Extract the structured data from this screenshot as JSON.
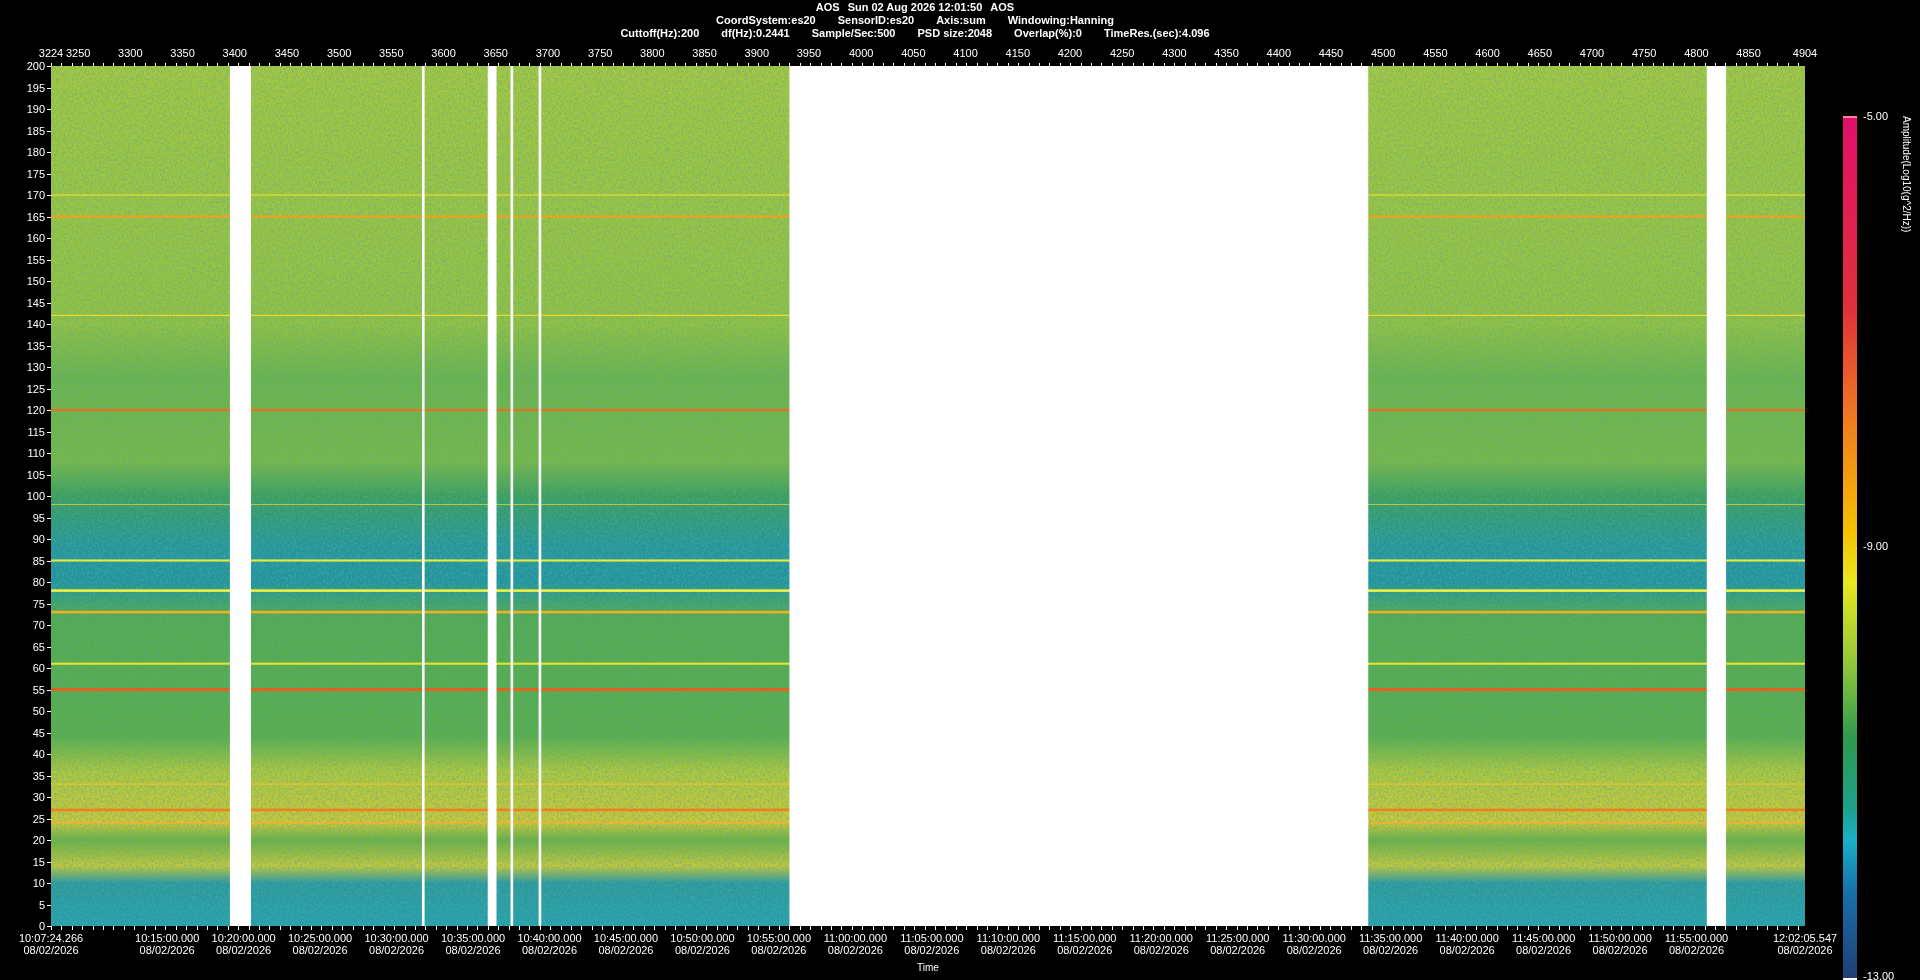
{
  "header": {
    "title": [
      "AOS",
      "Sun 02 Aug 2026 12:01:50",
      "AOS"
    ],
    "lines": [
      [
        "CoordSystem:es20",
        "SensorID:es20",
        "Axis:sum",
        "Windowing:Hanning"
      ],
      [
        "Cuttoff(Hz):200",
        "df(Hz):0.2441",
        "Sample/Sec:500",
        "PSD size:2048",
        "Overlap(%):0",
        "TimeRes.(sec):4.096"
      ]
    ]
  },
  "index_axis": {
    "labels": [
      "3224",
      "3250",
      "3300",
      "3350",
      "3400",
      "3450",
      "3500",
      "3550",
      "3600",
      "3650",
      "3700",
      "3750",
      "3800",
      "3850",
      "3900",
      "3950",
      "4000",
      "4050",
      "4100",
      "4150",
      "4200",
      "4250",
      "4300",
      "4350",
      "4400",
      "4450",
      "4500",
      "4550",
      "4600",
      "4650",
      "4700",
      "4750",
      "4800",
      "4850",
      "4904"
    ]
  },
  "frequency_axis": {
    "labels": [
      "200",
      "195",
      "190",
      "185",
      "180",
      "175",
      "170",
      "165",
      "160",
      "155",
      "150",
      "145",
      "140",
      "135",
      "130",
      "125",
      "120",
      "115",
      "110",
      "105",
      "100",
      "95",
      "90",
      "85",
      "80",
      "75",
      "70",
      "65",
      "60",
      "55",
      "50",
      "45",
      "40",
      "35",
      "30",
      "25",
      "20",
      "15",
      "10",
      "5",
      "0"
    ]
  },
  "time_axis": {
    "title": "Time",
    "ticks": [
      {
        "time": "10:07:24.266",
        "date": "08/02/2026"
      },
      {
        "time": "10:15:00.000",
        "date": "08/02/2026"
      },
      {
        "time": "10:20:00.000",
        "date": "08/02/2026"
      },
      {
        "time": "10:25:00.000",
        "date": "08/02/2026"
      },
      {
        "time": "10:30:00.000",
        "date": "08/02/2026"
      },
      {
        "time": "10:35:00.000",
        "date": "08/02/2026"
      },
      {
        "time": "10:40:00.000",
        "date": "08/02/2026"
      },
      {
        "time": "10:45:00.000",
        "date": "08/02/2026"
      },
      {
        "time": "10:50:00.000",
        "date": "08/02/2026"
      },
      {
        "time": "10:55:00.000",
        "date": "08/02/2026"
      },
      {
        "time": "11:00:00.000",
        "date": "08/02/2026"
      },
      {
        "time": "11:05:00.000",
        "date": "08/02/2026"
      },
      {
        "time": "11:10:00.000",
        "date": "08/02/2026"
      },
      {
        "time": "11:15:00.000",
        "date": "08/02/2026"
      },
      {
        "time": "11:20:00.000",
        "date": "08/02/2026"
      },
      {
        "time": "11:25:00.000",
        "date": "08/02/2026"
      },
      {
        "time": "11:30:00.000",
        "date": "08/02/2026"
      },
      {
        "time": "11:35:00.000",
        "date": "08/02/2026"
      },
      {
        "time": "11:40:00.000",
        "date": "08/02/2026"
      },
      {
        "time": "11:45:00.000",
        "date": "08/02/2026"
      },
      {
        "time": "11:50:00.000",
        "date": "08/02/2026"
      },
      {
        "time": "11:55:00.000",
        "date": "08/02/2026"
      },
      {
        "time": "12:02:05.547",
        "date": "08/02/2026"
      }
    ]
  },
  "colorbar": {
    "title": "Amplitude(Log10(g^2/Hz))",
    "labels": [
      "-5.00",
      "-9.00",
      "-13.00"
    ]
  }
}
